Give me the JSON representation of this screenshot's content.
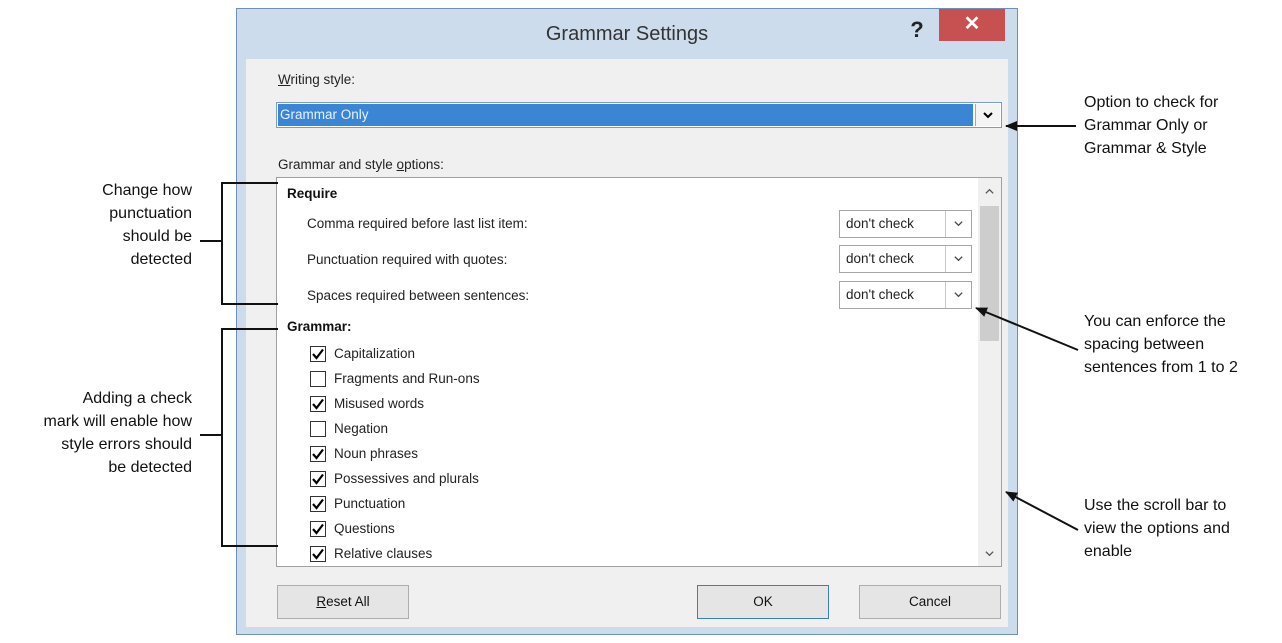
{
  "dialog": {
    "title": "Grammar Settings",
    "help_label": "?",
    "close_label": "✕"
  },
  "writing_style": {
    "label_accel": "W",
    "label_rest": "riting style:",
    "value": "Grammar Only",
    "arrow": "⌄"
  },
  "options": {
    "label_pre": "Grammar and style ",
    "label_accel": "o",
    "label_post": "ptions:",
    "require_heading": "Require",
    "require_rows": [
      {
        "label": "Comma required before last list item:",
        "value": "don't check"
      },
      {
        "label": "Punctuation required with quotes:",
        "value": "don't check"
      },
      {
        "label": "Spaces required between sentences:",
        "value": "don't check"
      }
    ],
    "grammar_heading": "Grammar:",
    "checkboxes": [
      {
        "label": "Capitalization",
        "checked": true
      },
      {
        "label": "Fragments and Run-ons",
        "checked": false
      },
      {
        "label": "Misused words",
        "checked": true
      },
      {
        "label": "Negation",
        "checked": false
      },
      {
        "label": "Noun phrases",
        "checked": true
      },
      {
        "label": "Possessives and plurals",
        "checked": true
      },
      {
        "label": "Punctuation",
        "checked": true
      },
      {
        "label": "Questions",
        "checked": true
      },
      {
        "label": "Relative clauses",
        "checked": true
      }
    ]
  },
  "buttons": {
    "reset_accel": "R",
    "reset_rest": "eset All",
    "ok": "OK",
    "cancel": "Cancel"
  },
  "annotations": {
    "writing_style": [
      "Option to check for",
      "Grammar Only or",
      "Grammar & Style"
    ],
    "punctuation": [
      "Change how",
      "punctuation",
      "should be",
      "detected"
    ],
    "check_mark": [
      "Adding a check",
      "mark will enable how",
      "style errors should",
      "be detected"
    ],
    "spacing": [
      "You can enforce the",
      "spacing between",
      "sentences from 1 to 2"
    ],
    "scroll": [
      "Use the scroll bar to",
      "view the options and",
      "enable"
    ]
  }
}
